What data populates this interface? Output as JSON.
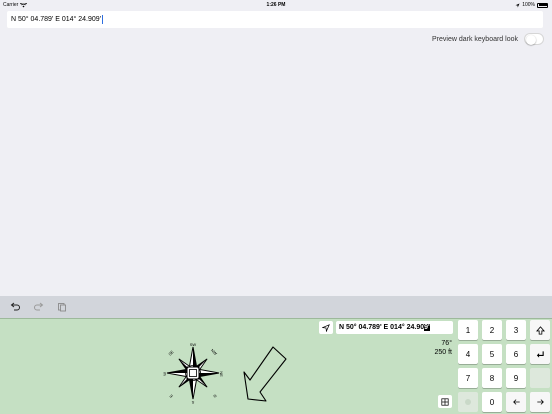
{
  "status": {
    "carrier": "Carrier",
    "time": "1:26 PM",
    "battery": "100%"
  },
  "field": {
    "before": "N 50° 04.789'  E 014° 24.90",
    "caret": "9'"
  },
  "preview": {
    "label": "Preview dark keyboard look",
    "enabled": false
  },
  "compass": {
    "labels": [
      "SW",
      "NW",
      "SE",
      "NE",
      "W",
      "E",
      "S",
      "N"
    ]
  },
  "keyboard": {
    "coord_main": "N 50° 04.789'  E 014° 24.90",
    "coord_sel": "9'",
    "bearing": "76°",
    "distance": "250 ft",
    "keys": [
      "1",
      "2",
      "3",
      "4",
      "5",
      "6",
      "7",
      "8",
      "9",
      "0"
    ]
  },
  "icons": {
    "undo": "undo-icon",
    "redo": "redo-icon",
    "paste": "paste-icon",
    "location": "location-arrow-icon",
    "shift": "shift-arrow-icon",
    "return": "return-icon",
    "left": "arrow-left-icon",
    "right": "arrow-right-icon",
    "grid": "grid-icon"
  },
  "colors": {
    "keyboard_bg": "#c5e0c3",
    "toolbar_bg": "#d2d5db",
    "page_bg": "#efeff4"
  }
}
